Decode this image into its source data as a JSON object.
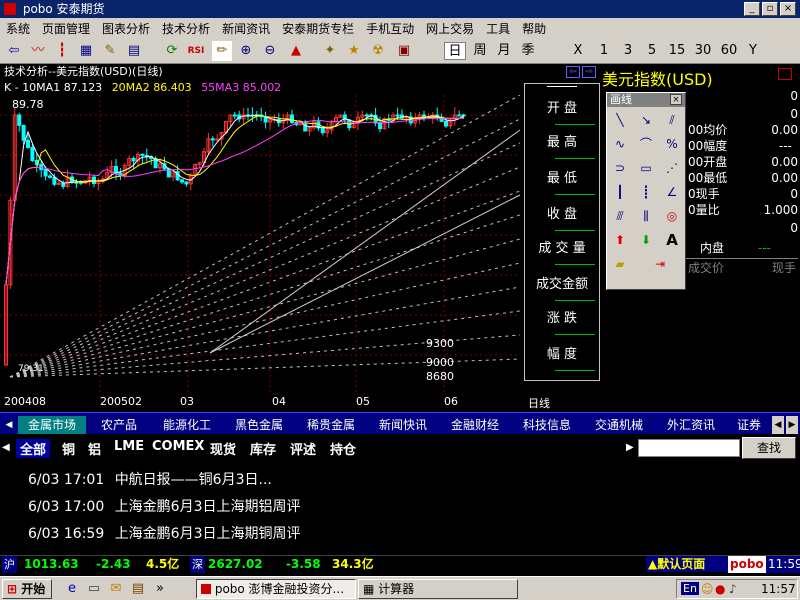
{
  "window": {
    "title": "pobo 安泰期货"
  },
  "menu": [
    "系统",
    "页面管理",
    "图表分析",
    "技术分析",
    "新闻资讯",
    "安泰期货专栏",
    "手机互动",
    "网上交易",
    "工具",
    "帮助"
  ],
  "toolbar": {
    "periods": [
      "日",
      "周",
      "月",
      "季",
      "X",
      "1",
      "3",
      "5",
      "15",
      "30",
      "60",
      "Y"
    ],
    "active_period": "日"
  },
  "chart": {
    "header": "技术分析--美元指数(USD)(日线)",
    "ma_prefix": "K - ",
    "ma": [
      {
        "label": "10MA1 87.123",
        "color": "#ffffff"
      },
      {
        "label": "20MA2 86.403",
        "color": "#ffff00"
      },
      {
        "label": "55MA3 85.002",
        "color": "#ff40ff"
      }
    ],
    "max_label": "89.78",
    "low_label": "79.31",
    "fan_labels": [
      "9300",
      "9000",
      "8680"
    ],
    "x_labels": [
      "200408",
      "200502",
      "03",
      "04",
      "05",
      "06"
    ],
    "period_label": "日线"
  },
  "quote_panel": {
    "rows": [
      "开    盘",
      "最    高",
      "最    低",
      "收    盘",
      "成 交 量",
      "成交金额",
      "涨    跌",
      "幅    度"
    ]
  },
  "right_panel": {
    "title": "美元指数(USD)",
    "rows": [
      {
        "label": "",
        "value": "0"
      },
      {
        "label": "",
        "value": "0"
      },
      {
        "label": "00均价",
        "value": "0.00"
      },
      {
        "label": "00幅度",
        "value": "---"
      },
      {
        "label": "00开盘",
        "value": "0.00"
      },
      {
        "label": "00最低",
        "value": "0.00"
      },
      {
        "label": "0现手",
        "value": "0"
      },
      {
        "label": "0量比",
        "value": "1.000"
      },
      {
        "label": "",
        "value": "0"
      }
    ],
    "neipan_label": "内盘",
    "neipan_value": "---",
    "volume_label": "成交价",
    "volume_label2": "现手"
  },
  "draw_palette": {
    "title": "画线"
  },
  "tabs": [
    "金属市场",
    "农产品",
    "能源化工",
    "黑色金属",
    "稀贵金属",
    "新闻快讯",
    "金融财经",
    "科技信息",
    "交通机械",
    "外汇资讯",
    "证券"
  ],
  "active_tab": "金属市场",
  "subtabs": [
    "全部",
    "铜",
    "铝",
    "LME",
    "COMEX",
    "现货",
    "库存",
    "评述",
    "持仓"
  ],
  "active_subtab": "全部",
  "search_button": "查找",
  "news": [
    {
      "time": "6/03 17:01",
      "title": "中航日报——铜6月3日..."
    },
    {
      "time": "6/03 17:00",
      "title": "上海金鹏6月3日上海期铝周评"
    },
    {
      "time": "6/03 16:59",
      "title": "上海金鹏6月3日上海期铜周评"
    }
  ],
  "status": {
    "sh_label": "沪",
    "sh_value": "1013.63",
    "sh_change": "-2.43",
    "sh_amount": "4.5亿",
    "sz_label": "深",
    "sz_value": "2627.02",
    "sz_change": "-3.58",
    "sz_amount": "34.3亿",
    "default_page": "默认页面",
    "brand": "pobo",
    "time": "11:59"
  },
  "taskbar": {
    "start": "开始",
    "items": [
      "pobo 澎博金融投资分...",
      "计算器"
    ],
    "clock": "11:57",
    "lang": "En"
  },
  "colors": {
    "up": "#ff3030",
    "down": "#00ffff",
    "ma1": "#ffffff",
    "ma2": "#ffff00",
    "ma3": "#ff40ff",
    "grid": "#800000"
  }
}
